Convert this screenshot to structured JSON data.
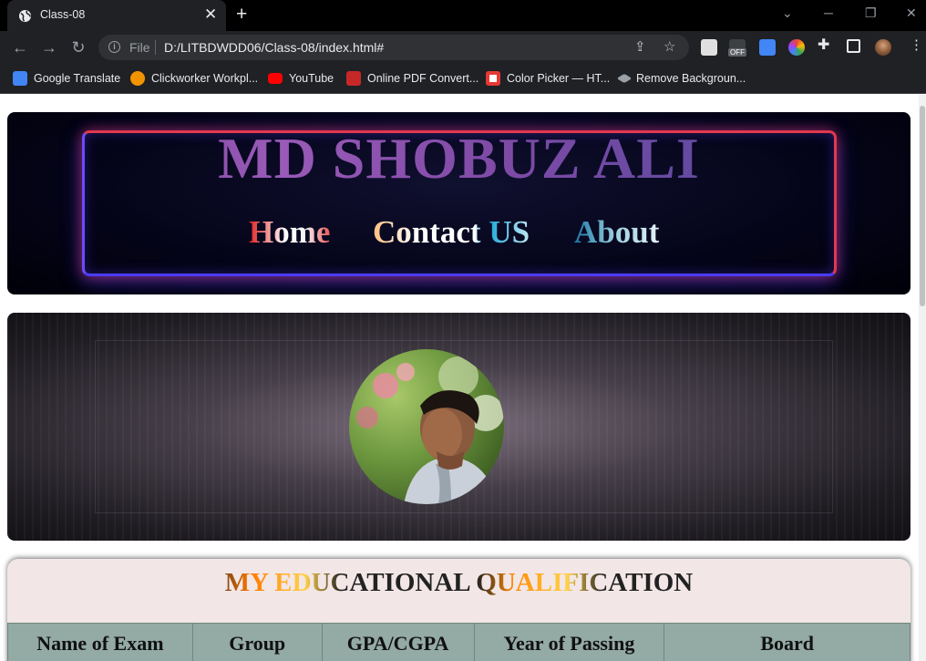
{
  "browser": {
    "tab_title": "Class-08",
    "tab_close_glyph": "✕",
    "new_tab_glyph": "+",
    "address": {
      "protocol_label": "File",
      "url": "D:/LITBDWDD06/Class-08/index.html#"
    },
    "extension_badge": "OFF",
    "bookmarks": [
      {
        "label": "Google Translate",
        "icon": "google-translate-icon",
        "color": "#4285f4"
      },
      {
        "label": "Clickworker Workpl...",
        "icon": "clickworker-icon",
        "color": "#f29400"
      },
      {
        "label": "YouTube",
        "icon": "youtube-icon",
        "color": "#ff0000"
      },
      {
        "label": "Online PDF Convert...",
        "icon": "pdf-icon",
        "color": "#c62828"
      },
      {
        "label": "Color Picker — HT...",
        "icon": "color-picker-icon",
        "color": "#e53935"
      },
      {
        "label": "Remove Backgroun...",
        "icon": "remove-bg-icon",
        "color": "#9aa0a6"
      }
    ]
  },
  "page": {
    "site_title": "MD SHOBUZ ALI",
    "nav": {
      "home": "Home",
      "contact": "Contact US",
      "about": "About"
    },
    "education": {
      "title": "MY EDUCATIONAL QUALIFICATION",
      "columns": [
        "Name of Exam",
        "Group",
        "GPA/CGPA",
        "Year of Passing",
        "Board"
      ]
    }
  },
  "colors": {
    "chrome_dark": "#202124",
    "neon_red": "#e2384d",
    "neon_blue": "#4a3cff",
    "table_header": "#94aaa4",
    "edu_panel": "#f3e6e6"
  }
}
